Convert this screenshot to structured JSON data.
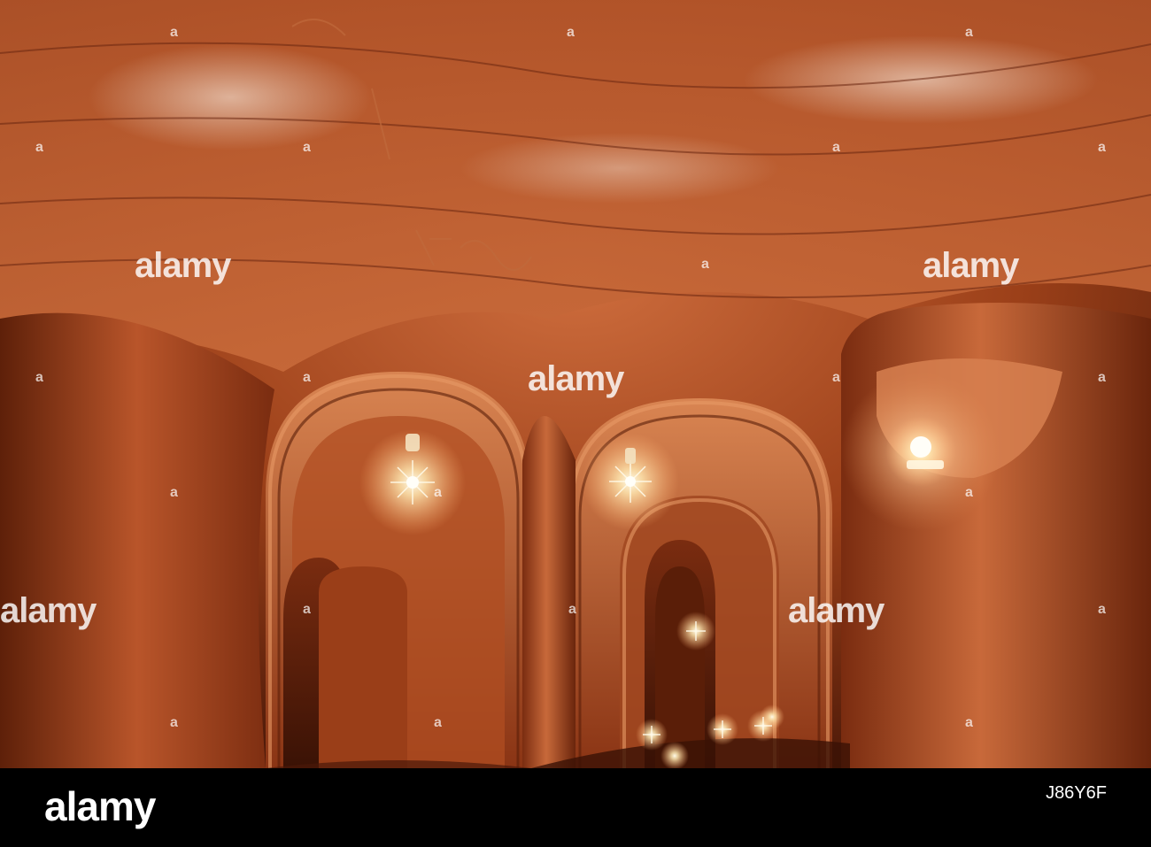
{
  "watermark": {
    "brand": "alamy",
    "image_id": "J86Y6F",
    "small_mark": "a"
  },
  "colors": {
    "rock_dark": "#5a200c",
    "rock_mid": "#a3441e",
    "rock_light": "#d97a4c",
    "lamp": "#fff6d6",
    "footer_bg": "#000000"
  }
}
